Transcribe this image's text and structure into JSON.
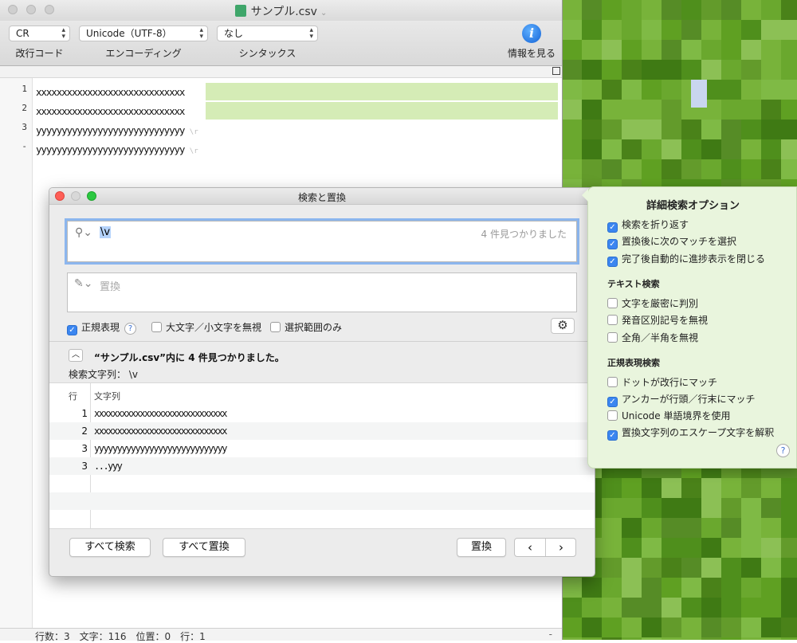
{
  "window": {
    "title": "サンプル.csv"
  },
  "toolbar": {
    "line_ending": {
      "value": "CR",
      "label": "改行コード"
    },
    "encoding": {
      "value": "Unicode（UTF-8）",
      "label": "エンコーディング"
    },
    "syntax": {
      "value": "なし",
      "label": "シンタックス"
    },
    "info_label": "情報を見る"
  },
  "editor": {
    "line_numbers": [
      "1",
      "2",
      "3",
      "-"
    ],
    "lines": [
      {
        "text": "xxxxxxxxxxxxxxxxxxxxxxxxxxxxx",
        "highlighted": true
      },
      {
        "text": "xxxxxxxxxxxxxxxxxxxxxxxxxxxxx",
        "highlighted": true
      },
      {
        "text": "yyyyyyyyyyyyyyyyyyyyyyyyyyyyy",
        "highlighted": false
      },
      {
        "text": "yyyyyyyyyyyyyyyyyyyyyyyyyyyyy",
        "highlighted": false
      }
    ],
    "highlight_color": "#d5ecb6"
  },
  "status": {
    "text": "行数：3　文字：116　位置：0　行：1",
    "dash": "-"
  },
  "find_panel": {
    "title": "検索と置換",
    "search_value": "\\v",
    "search_count": "4 件見つかりました",
    "replace_placeholder": "置換",
    "options": {
      "regex": "正規表現",
      "ignore_case": "大文字／小文字を無視",
      "selection_only": "選択範囲のみ"
    },
    "result_title": "“サンプル.csv”内に 4 件見つかりました。",
    "search_string": "検索文字列：  \\v",
    "columns": [
      "行",
      "文字列"
    ],
    "rows": [
      {
        "line": "1",
        "text": "xxxxxxxxxxxxxxxxxxxxxxxxxxxxx"
      },
      {
        "line": "2",
        "text": "xxxxxxxxxxxxxxxxxxxxxxxxxxxxx"
      },
      {
        "line": "3",
        "text": "yyyyyyyyyyyyyyyyyyyyyyyyyyyyy"
      },
      {
        "line": "3",
        "text": "...yyy"
      }
    ],
    "buttons": {
      "find_all": "すべて検索",
      "replace_all": "すべて置換",
      "replace": "置換",
      "prev": "‹",
      "next": "›"
    }
  },
  "advanced": {
    "title": "詳細検索オプション",
    "general": [
      {
        "label": "検索を折り返す",
        "checked": true
      },
      {
        "label": "置換後に次のマッチを選択",
        "checked": true
      },
      {
        "label": "完了後自動的に進捗表示を閉じる",
        "checked": true
      }
    ],
    "text_section": "テキスト検索",
    "text_options": [
      {
        "label": "文字を厳密に判別",
        "checked": false
      },
      {
        "label": "発音区別記号を無視",
        "checked": false
      },
      {
        "label": "全角／半角を無視",
        "checked": false
      }
    ],
    "regex_section": "正規表現検索",
    "regex_options": [
      {
        "label": "ドットが改行にマッチ",
        "checked": false
      },
      {
        "label": "アンカーが行頭／行末にマッチ",
        "checked": true
      },
      {
        "label": "Unicode 単語境界を使用",
        "checked": false
      },
      {
        "label": "置換文字列のエスケープ文字を解釈",
        "checked": true
      }
    ],
    "panel_color": "#e9f5dd"
  }
}
